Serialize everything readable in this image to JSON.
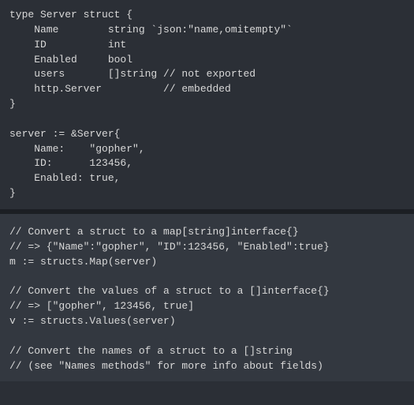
{
  "top_block": "type Server struct {\n    Name        string `json:\"name,omitempty\"`\n    ID          int\n    Enabled     bool\n    users       []string // not exported\n    http.Server          // embedded\n}\n\nserver := &Server{\n    Name:    \"gopher\",\n    ID:      123456,\n    Enabled: true,\n}",
  "bottom_block": "// Convert a struct to a map[string]interface{}\n// => {\"Name\":\"gopher\", \"ID\":123456, \"Enabled\":true}\nm := structs.Map(server)\n\n// Convert the values of a struct to a []interface{}\n// => [\"gopher\", 123456, true]\nv := structs.Values(server)\n\n// Convert the names of a struct to a []string\n// (see \"Names methods\" for more info about fields)"
}
